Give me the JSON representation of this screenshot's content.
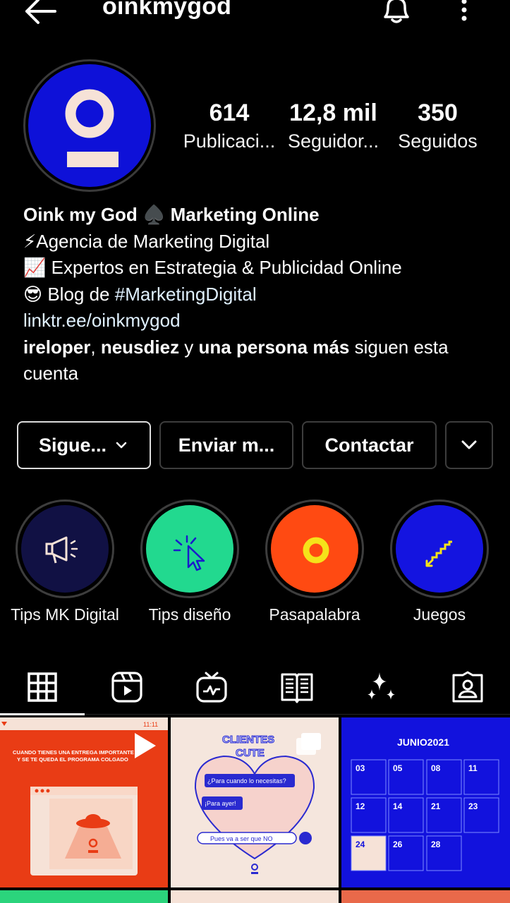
{
  "header": {
    "username": "oinkmygod",
    "icons": [
      "back-arrow-icon",
      "bell-icon",
      "more-vertical-icon"
    ]
  },
  "profile": {
    "stats": [
      {
        "value": "614",
        "label": "Publicaci..."
      },
      {
        "value": "12,8 mil",
        "label": "Seguidor..."
      },
      {
        "value": "350",
        "label": "Seguidos"
      }
    ],
    "bio": {
      "name": "Oink my God ♠️ Marketing Online",
      "line1": "⚡Agencia de Marketing Digital",
      "line2": "📈 Expertos en Estrategia & Publicidad Online",
      "line3_prefix": "😎 Blog de ",
      "line3_hashtag": "#MarketingDigital",
      "link": "linktr.ee/oinkmygod",
      "followed_by_user1": "ireloper",
      "followed_by_sep": ", ",
      "followed_by_user2": "neusdiez",
      "followed_by_and": " y ",
      "followed_by_more": "una persona más",
      "followed_by_suffix": " siguen esta",
      "followed_by_suffix2": "cuenta"
    }
  },
  "actions": {
    "following": "Sigue...",
    "message": "Enviar m...",
    "contact": "Contactar"
  },
  "highlights": [
    {
      "label": "Tips MK Digital",
      "color": "#111144",
      "icon": "megaphone-icon"
    },
    {
      "label": "Tips diseño",
      "color": "#22d98f",
      "icon": "cursor-click-icon"
    },
    {
      "label": "Pasapalabra",
      "color": "#ff4a12",
      "icon": "ring-icon"
    },
    {
      "label": "Juegos",
      "color": "#1414e0",
      "icon": "ladder-arrow-icon"
    }
  ],
  "tabs": [
    "grid-icon",
    "reels-icon",
    "igtv-icon",
    "guides-icon",
    "effects-icon",
    "tagged-icon"
  ],
  "posts": {
    "post1": {
      "text": "CUANDO TIENES UNA ENTREGA IMPORTANTE Y SE TE QUEDA EL PROGRAMA COLGADO",
      "time": "11:11"
    },
    "post2": {
      "title1": "CLIENTES",
      "title2": "CUTE",
      "bubble1": "¿Para cuando lo necesitas?",
      "bubble2": "¡Para ayer!",
      "bubble3": "Pues va a ser que NO"
    },
    "post3": {
      "title": "JUNIO2021",
      "days": [
        "03",
        "05",
        "08",
        "11",
        "12",
        "14",
        "21",
        "23",
        "24",
        "26",
        "28"
      ]
    }
  },
  "colors": {
    "brand_blue": "#0e11d8",
    "brand_cream": "#f6e2d7",
    "orange": "#e93c15"
  }
}
